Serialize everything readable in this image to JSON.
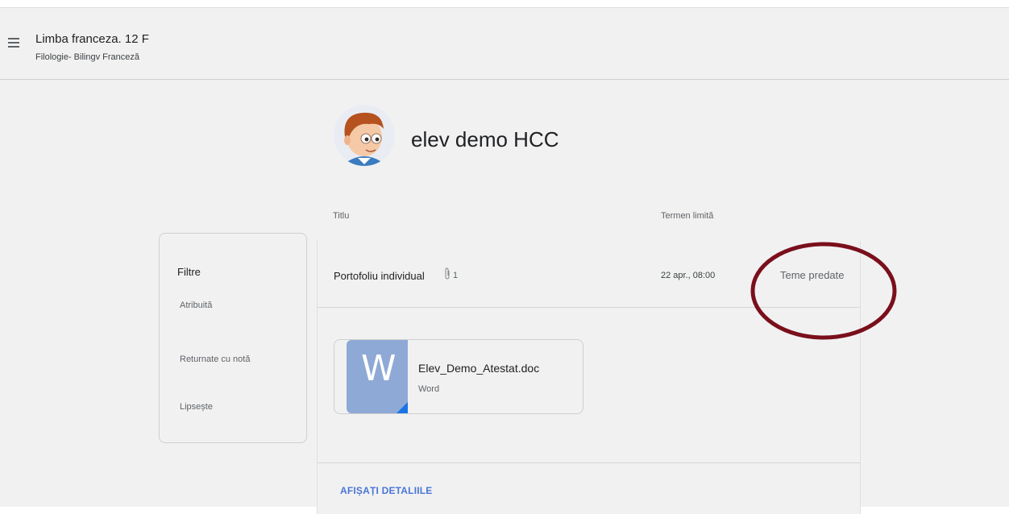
{
  "header": {
    "course_title": "Limba franceza. 12 F",
    "course_subtitle": "Filologie- Bilingv Franceză"
  },
  "student": {
    "name": "elev demo HCC"
  },
  "columns": {
    "title": "Titlu",
    "due": "Termen limită"
  },
  "filters": {
    "title": "Filtre",
    "items": [
      "Atribuită",
      "Returnate cu notă",
      "Lipsește"
    ]
  },
  "assignment": {
    "title": "Portofoliu individual",
    "attachment_count": "1",
    "due": "22 apr., 08:00",
    "status": "Teme predate"
  },
  "file": {
    "thumb_letter": "W",
    "name": "Elev_Demo_Atestat.doc",
    "type": "Word"
  },
  "details": {
    "link_label": "AFIȘAȚI DETALIILE"
  },
  "colors": {
    "link": "#4a76d8",
    "annotation_circle": "#7a0f1c",
    "word_thumb": "#8fa9d6",
    "word_corner": "#1a73e8"
  }
}
